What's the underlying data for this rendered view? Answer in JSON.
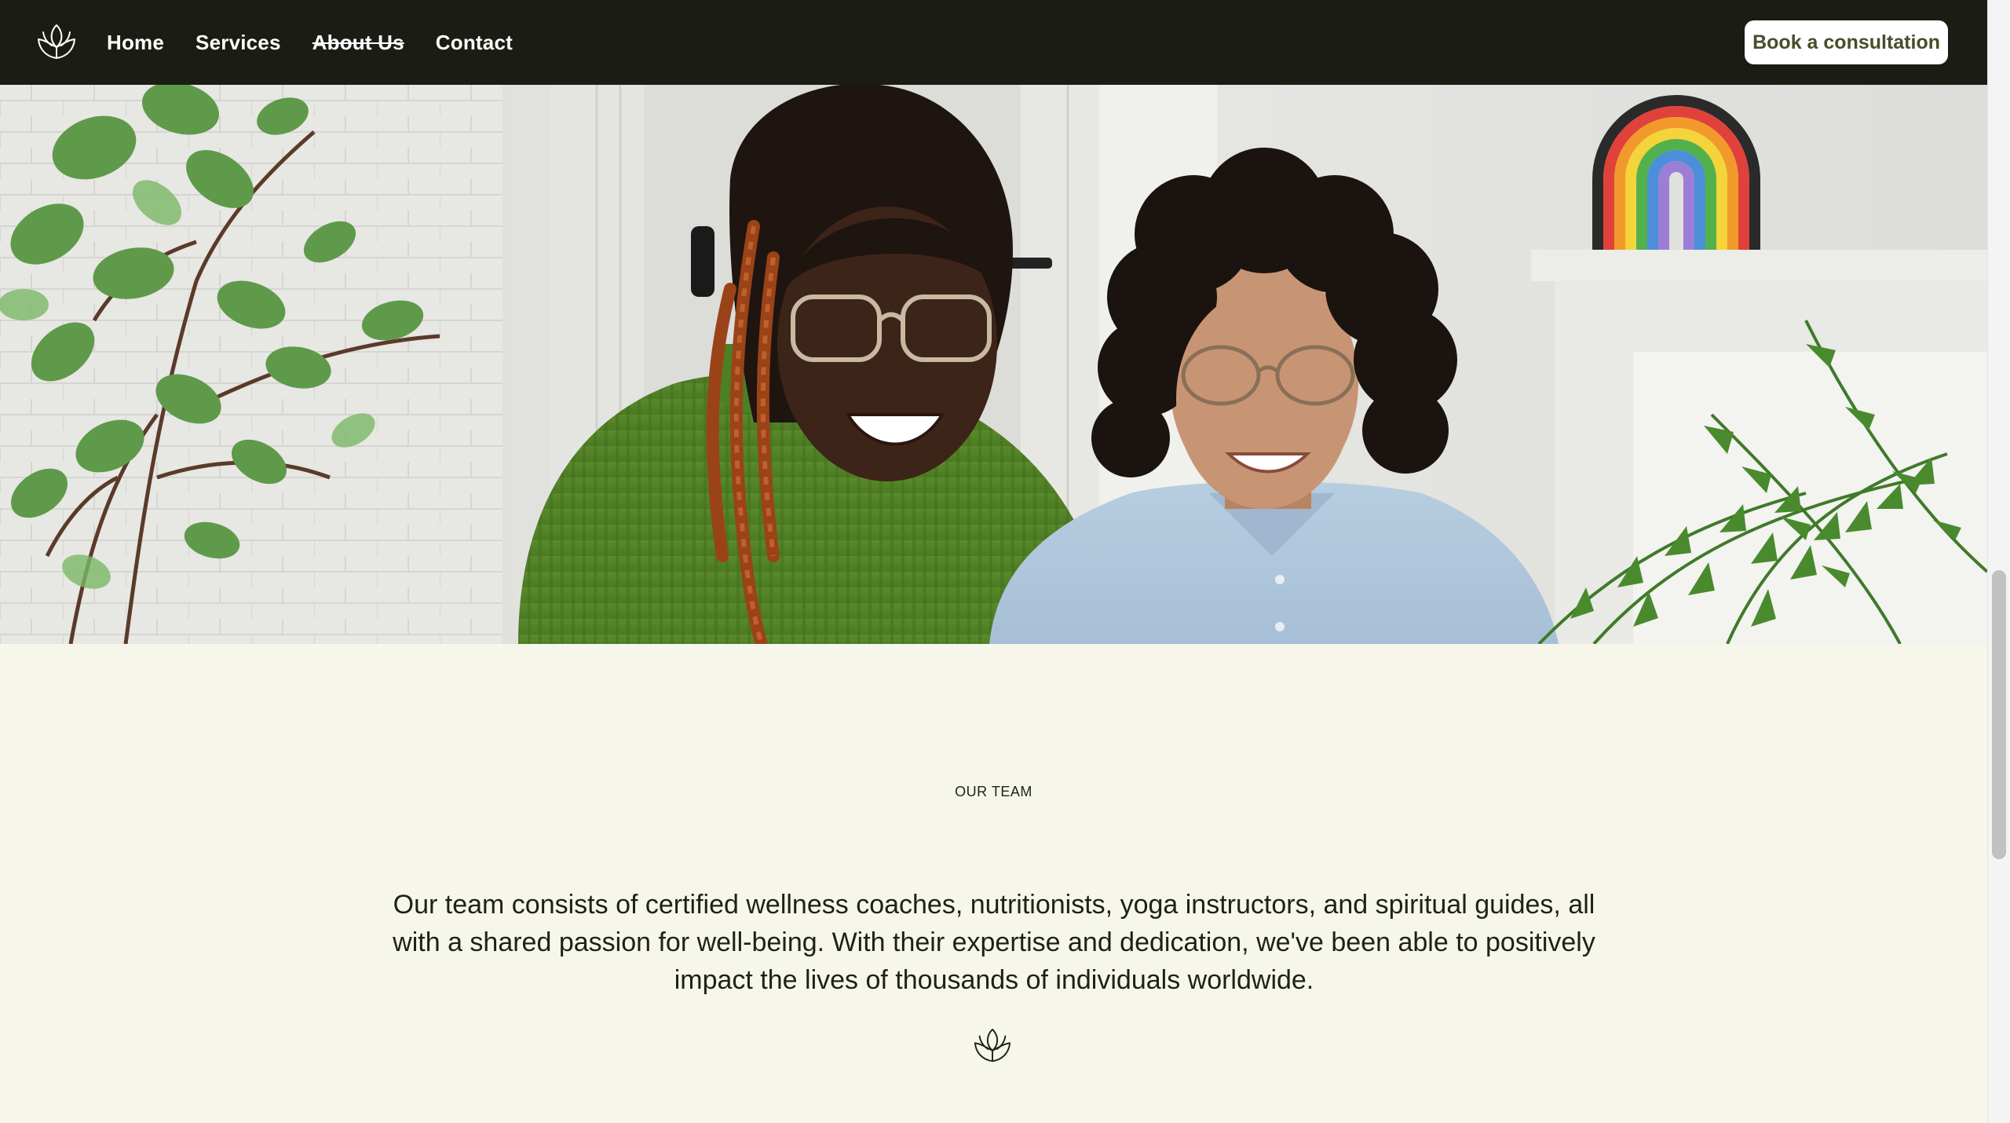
{
  "nav": {
    "logo_icon": "lotus-icon",
    "links": [
      {
        "label": "Home"
      },
      {
        "label": "Services"
      },
      {
        "label": "About Us"
      },
      {
        "label": "Contact"
      }
    ],
    "cta_label": "Book a consultation"
  },
  "team": {
    "eyebrow": "OUR TEAM",
    "description": "Our team consists of certified wellness coaches, nutritionists, yoga instructors, and spiritual guides, all with a shared passion for well-being. With their expertise and dedication, we've been able to positively impact the lives of thousands of individuals worldwide.",
    "divider_icon": "lotus-icon"
  },
  "colors": {
    "nav_background": "#1b1d14",
    "page_background": "#f7f6ea",
    "cta_text": "#454f2a",
    "text": "#1f2118"
  }
}
